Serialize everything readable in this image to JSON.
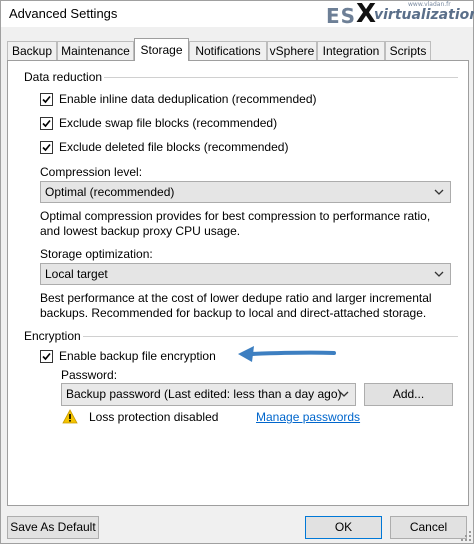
{
  "window": {
    "title": "Advanced Settings"
  },
  "watermark": {
    "es": "ES",
    "x": "X",
    "virtualization": "virtualization",
    "site": "www.vladan.fr"
  },
  "tabs": [
    {
      "label": "Backup"
    },
    {
      "label": "Maintenance"
    },
    {
      "label": "Storage"
    },
    {
      "label": "Notifications"
    },
    {
      "label": "vSphere"
    },
    {
      "label": "Integration"
    },
    {
      "label": "Scripts"
    }
  ],
  "active_tab": "Storage",
  "data_reduction": {
    "group_label": "Data reduction",
    "inline_dedup": {
      "label": "Enable inline data deduplication (recommended)",
      "checked": true
    },
    "swap_blocks": {
      "label": "Exclude swap file blocks (recommended)",
      "checked": true
    },
    "deleted_blocks": {
      "label": "Exclude deleted file blocks (recommended)",
      "checked": true
    },
    "compression": {
      "label": "Compression level:",
      "value": "Optimal (recommended)",
      "desc_line1": "Optimal compression provides for best compression to performance ratio,",
      "desc_line2": "and lowest backup proxy CPU usage."
    },
    "storage_opt": {
      "label": "Storage optimization:",
      "value": "Local target",
      "desc_line1": "Best performance at the cost of lower dedupe ratio and larger incremental",
      "desc_line2": "backups. Recommended for backup to local and direct-attached storage."
    }
  },
  "encryption": {
    "group_label": "Encryption",
    "enable": {
      "label": "Enable backup file encryption",
      "checked": true
    },
    "password_label": "Password:",
    "password_value": "Backup password (Last edited: less than a day ago)",
    "add_button": "Add...",
    "warning_text": "Loss protection disabled",
    "manage_link": "Manage passwords"
  },
  "footer": {
    "save_default": "Save As Default",
    "ok": "OK",
    "cancel": "Cancel"
  },
  "colors": {
    "link": "#0066cc",
    "arrow": "#3d7fc1",
    "warning": "#f5c400",
    "accent": "#0078d7"
  }
}
